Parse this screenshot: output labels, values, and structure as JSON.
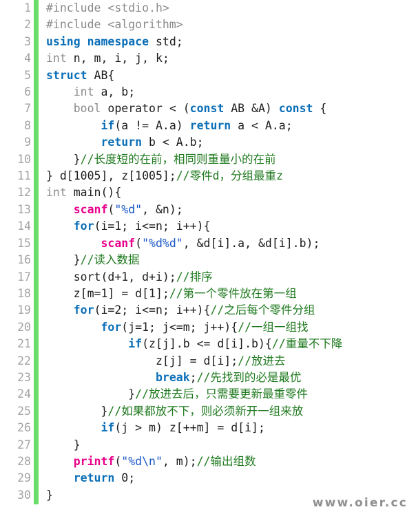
{
  "editor": {
    "language": "C++",
    "theme_colors": {
      "background": "#ffffff",
      "gutter_text": "#a3a3a3",
      "gutter_bar": "#6bdd6b",
      "plain": "#1c1c1c",
      "preprocessor": "#8b8b8b",
      "type": "#8b8b8b",
      "keyword": "#0b6fb8",
      "function": "#e8008a",
      "string": "#1a57c8",
      "comment": "#1f7a1f",
      "watermark": "#8f8f8f"
    },
    "first_line_number": 1,
    "last_line_number": 30,
    "total_lines": 30
  },
  "watermark": {
    "text": "www.oier.cc"
  },
  "lines": [
    {
      "n": "1",
      "tokens": [
        {
          "t": "pre",
          "v": "#include <stdio.h>"
        }
      ]
    },
    {
      "n": "2",
      "tokens": [
        {
          "t": "pre",
          "v": "#include <algorithm>"
        }
      ]
    },
    {
      "n": "3",
      "tokens": [
        {
          "t": "kw",
          "v": "using namespace"
        },
        {
          "t": "plain",
          "v": " std;"
        }
      ]
    },
    {
      "n": "4",
      "tokens": [
        {
          "t": "type",
          "v": "int"
        },
        {
          "t": "plain",
          "v": " n, m, i, j, k;"
        }
      ]
    },
    {
      "n": "5",
      "tokens": [
        {
          "t": "kw",
          "v": "struct"
        },
        {
          "t": "plain",
          "v": " AB{"
        }
      ]
    },
    {
      "n": "6",
      "tokens": [
        {
          "t": "plain",
          "v": "    "
        },
        {
          "t": "type",
          "v": "int"
        },
        {
          "t": "plain",
          "v": " a, b;"
        }
      ]
    },
    {
      "n": "7",
      "tokens": [
        {
          "t": "plain",
          "v": "    "
        },
        {
          "t": "type",
          "v": "bool"
        },
        {
          "t": "plain",
          "v": " operator < ("
        },
        {
          "t": "kw",
          "v": "const"
        },
        {
          "t": "plain",
          "v": " AB &A) "
        },
        {
          "t": "kw",
          "v": "const"
        },
        {
          "t": "plain",
          "v": " {"
        }
      ]
    },
    {
      "n": "8",
      "tokens": [
        {
          "t": "plain",
          "v": "        "
        },
        {
          "t": "kw",
          "v": "if"
        },
        {
          "t": "plain",
          "v": "(a != A.a) "
        },
        {
          "t": "kw",
          "v": "return"
        },
        {
          "t": "plain",
          "v": " a < A.a;"
        }
      ]
    },
    {
      "n": "9",
      "tokens": [
        {
          "t": "plain",
          "v": "        "
        },
        {
          "t": "kw",
          "v": "return"
        },
        {
          "t": "plain",
          "v": " b < A.b;"
        }
      ]
    },
    {
      "n": "10",
      "tokens": [
        {
          "t": "plain",
          "v": "    }"
        },
        {
          "t": "cmt",
          "v": "//长度短的在前，相同则重量小的在前"
        }
      ]
    },
    {
      "n": "11",
      "tokens": [
        {
          "t": "plain",
          "v": "} d[1005], z[1005];"
        },
        {
          "t": "cmt",
          "v": "//零件d，分组最重z"
        }
      ]
    },
    {
      "n": "12",
      "tokens": [
        {
          "t": "type",
          "v": "int"
        },
        {
          "t": "plain",
          "v": " main(){"
        }
      ]
    },
    {
      "n": "13",
      "tokens": [
        {
          "t": "plain",
          "v": "    "
        },
        {
          "t": "fn",
          "v": "scanf"
        },
        {
          "t": "plain",
          "v": "("
        },
        {
          "t": "str",
          "v": "\"%d\""
        },
        {
          "t": "plain",
          "v": ", &n);"
        }
      ]
    },
    {
      "n": "14",
      "tokens": [
        {
          "t": "plain",
          "v": "    "
        },
        {
          "t": "kw",
          "v": "for"
        },
        {
          "t": "plain",
          "v": "(i=1; i<=n; i++){"
        }
      ]
    },
    {
      "n": "15",
      "tokens": [
        {
          "t": "plain",
          "v": "        "
        },
        {
          "t": "fn",
          "v": "scanf"
        },
        {
          "t": "plain",
          "v": "("
        },
        {
          "t": "str",
          "v": "\"%d%d\""
        },
        {
          "t": "plain",
          "v": ", &d[i].a, &d[i].b);"
        }
      ]
    },
    {
      "n": "16",
      "tokens": [
        {
          "t": "plain",
          "v": "    }"
        },
        {
          "t": "cmt",
          "v": "//读入数据"
        }
      ]
    },
    {
      "n": "17",
      "tokens": [
        {
          "t": "plain",
          "v": "    sort(d+1, d+i);"
        },
        {
          "t": "cmt",
          "v": "//排序"
        }
      ]
    },
    {
      "n": "18",
      "tokens": [
        {
          "t": "plain",
          "v": "    z[m=1] = d[1];"
        },
        {
          "t": "cmt",
          "v": "//第一个零件放在第一组"
        }
      ]
    },
    {
      "n": "19",
      "tokens": [
        {
          "t": "plain",
          "v": "    "
        },
        {
          "t": "kw",
          "v": "for"
        },
        {
          "t": "plain",
          "v": "(i=2; i<=n; i++){"
        },
        {
          "t": "cmt",
          "v": "//之后每个零件分组"
        }
      ]
    },
    {
      "n": "20",
      "tokens": [
        {
          "t": "plain",
          "v": "        "
        },
        {
          "t": "kw",
          "v": "for"
        },
        {
          "t": "plain",
          "v": "(j=1; j<=m; j++){"
        },
        {
          "t": "cmt",
          "v": "//一组一组找"
        }
      ]
    },
    {
      "n": "21",
      "tokens": [
        {
          "t": "plain",
          "v": "            "
        },
        {
          "t": "kw",
          "v": "if"
        },
        {
          "t": "plain",
          "v": "(z[j].b <= d[i].b){"
        },
        {
          "t": "cmt",
          "v": "//重量不下降"
        }
      ]
    },
    {
      "n": "22",
      "tokens": [
        {
          "t": "plain",
          "v": "                z[j] = d[i];"
        },
        {
          "t": "cmt",
          "v": "//放进去"
        }
      ]
    },
    {
      "n": "23",
      "tokens": [
        {
          "t": "plain",
          "v": "                "
        },
        {
          "t": "kw",
          "v": "break"
        },
        {
          "t": "plain",
          "v": ";"
        },
        {
          "t": "cmt",
          "v": "//先找到的必是最优"
        }
      ]
    },
    {
      "n": "24",
      "tokens": [
        {
          "t": "plain",
          "v": "            }"
        },
        {
          "t": "cmt",
          "v": "//放进去后，只需要更新最重零件"
        }
      ]
    },
    {
      "n": "25",
      "tokens": [
        {
          "t": "plain",
          "v": "        }"
        },
        {
          "t": "cmt",
          "v": "//如果都放不下，则必须新开一组来放"
        }
      ]
    },
    {
      "n": "26",
      "tokens": [
        {
          "t": "plain",
          "v": "        "
        },
        {
          "t": "kw",
          "v": "if"
        },
        {
          "t": "plain",
          "v": "(j > m) z[++m] = d[i];"
        }
      ]
    },
    {
      "n": "27",
      "tokens": [
        {
          "t": "plain",
          "v": "    }"
        }
      ]
    },
    {
      "n": "28",
      "tokens": [
        {
          "t": "plain",
          "v": "    "
        },
        {
          "t": "fn",
          "v": "printf"
        },
        {
          "t": "plain",
          "v": "("
        },
        {
          "t": "str",
          "v": "\"%d\\n\""
        },
        {
          "t": "plain",
          "v": ", m);"
        },
        {
          "t": "cmt",
          "v": "//输出组数"
        }
      ]
    },
    {
      "n": "29",
      "tokens": [
        {
          "t": "plain",
          "v": "    "
        },
        {
          "t": "kw",
          "v": "return"
        },
        {
          "t": "plain",
          "v": " 0;"
        }
      ]
    },
    {
      "n": "30",
      "tokens": [
        {
          "t": "plain",
          "v": "}"
        }
      ]
    }
  ]
}
